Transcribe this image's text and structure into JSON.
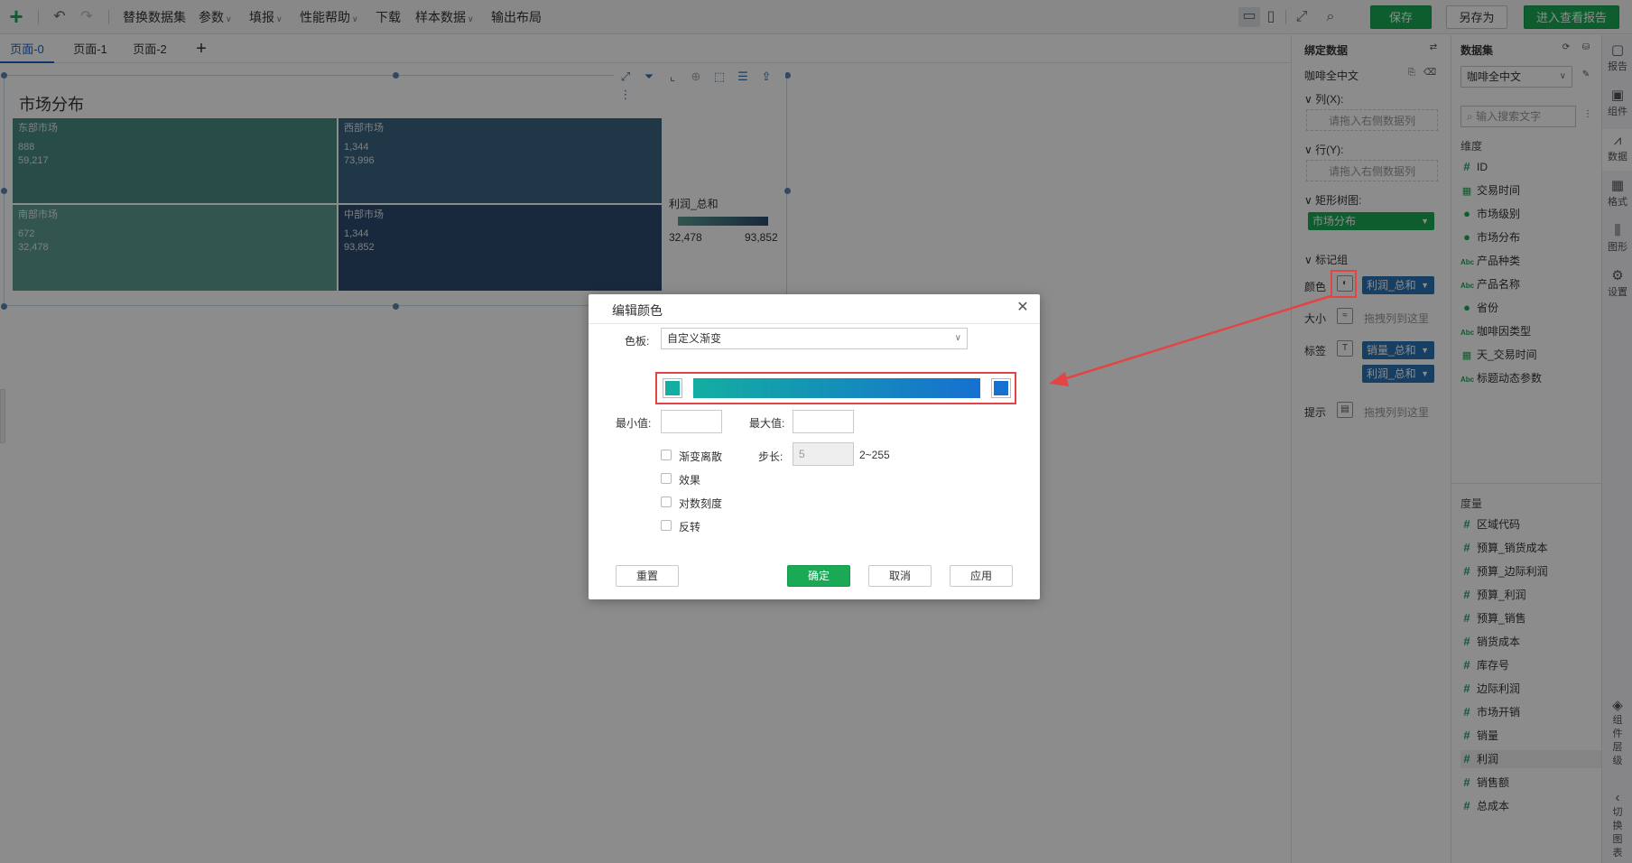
{
  "toolbar": {
    "items": [
      "替换数据集",
      "参数",
      "填报",
      "性能帮助",
      "下载",
      "样本数据",
      "输出布局"
    ],
    "save": "保存",
    "save_as": "另存为",
    "enter_report": "进入查看报告"
  },
  "tabs": [
    "页面-0",
    "页面-1",
    "页面-2"
  ],
  "chart": {
    "title": "市场分布",
    "cells": [
      {
        "name": "东部市场",
        "v1": "888",
        "v2": "59,217"
      },
      {
        "name": "西部市场",
        "v1": "1,344",
        "v2": "73,996"
      },
      {
        "name": "南部市场",
        "v1": "672",
        "v2": "32,478"
      },
      {
        "name": "中部市场",
        "v1": "1,344",
        "v2": "93,852"
      }
    ],
    "legend_title": "利润_总和",
    "legend_min": "32,478",
    "legend_max": "93,852"
  },
  "bind": {
    "header": "绑定数据",
    "dataset": "咖啡全中文",
    "col_label": "列(X):",
    "col_drop": "请拖入右侧数据列",
    "row_label": "行(Y):",
    "row_drop": "请拖入右侧数据列",
    "treemap_label": "矩形树图:",
    "treemap_pill": "市场分布",
    "marks_label": "标记组",
    "color_label": "颜色",
    "color_pill": "利润_总和",
    "size_label": "大小",
    "size_drop": "拖拽列到这里",
    "label_label": "标签",
    "label_pill1": "销量_总和",
    "label_pill2": "利润_总和",
    "tip_label": "提示",
    "tip_drop": "拖拽列到这里"
  },
  "dataset_panel": {
    "header": "数据集",
    "selected": "咖啡全中文",
    "search_placeholder": "输入搜索文字",
    "dim_label": "维度",
    "dimensions": [
      {
        "icon": "#",
        "label": "ID"
      },
      {
        "icon": "cal",
        "label": "交易时间"
      },
      {
        "icon": "geo",
        "label": "市场级别"
      },
      {
        "icon": "geo",
        "label": "市场分布"
      },
      {
        "icon": "Abc",
        "label": "产品种类"
      },
      {
        "icon": "Abc",
        "label": "产品名称"
      },
      {
        "icon": "geo",
        "label": "省份"
      },
      {
        "icon": "Abc",
        "label": "咖啡因类型"
      },
      {
        "icon": "cal",
        "label": "天_交易时间"
      },
      {
        "icon": "Abc",
        "label": "标题动态参数"
      }
    ],
    "measure_label": "度量",
    "measures": [
      "区域代码",
      "预算_销货成本",
      "预算_边际利润",
      "预算_利润",
      "预算_销售",
      "销货成本",
      "库存号",
      "边际利润",
      "市场开销",
      "销量",
      "利润",
      "销售额",
      "总成本"
    ]
  },
  "rail": {
    "items": [
      "报告",
      "组件",
      "数据",
      "格式",
      "图形",
      "设置"
    ],
    "bottom1": [
      "组",
      "件",
      "层",
      "级"
    ],
    "bottom2": [
      "切",
      "换",
      "图",
      "表"
    ]
  },
  "dialog": {
    "title": "编辑颜色",
    "palette_label": "色板:",
    "palette_value": "自定义渐变",
    "min_label": "最小值:",
    "max_label": "最大值:",
    "discrete": "渐变离散",
    "step_label": "步长:",
    "step_value": "5",
    "step_range": "2~255",
    "effect": "效果",
    "log_scale": "对数刻度",
    "reverse": "反转",
    "reset": "重置",
    "ok": "确定",
    "cancel": "取消",
    "apply": "应用",
    "start_color": "#13aea1",
    "end_color": "#1670d1"
  }
}
